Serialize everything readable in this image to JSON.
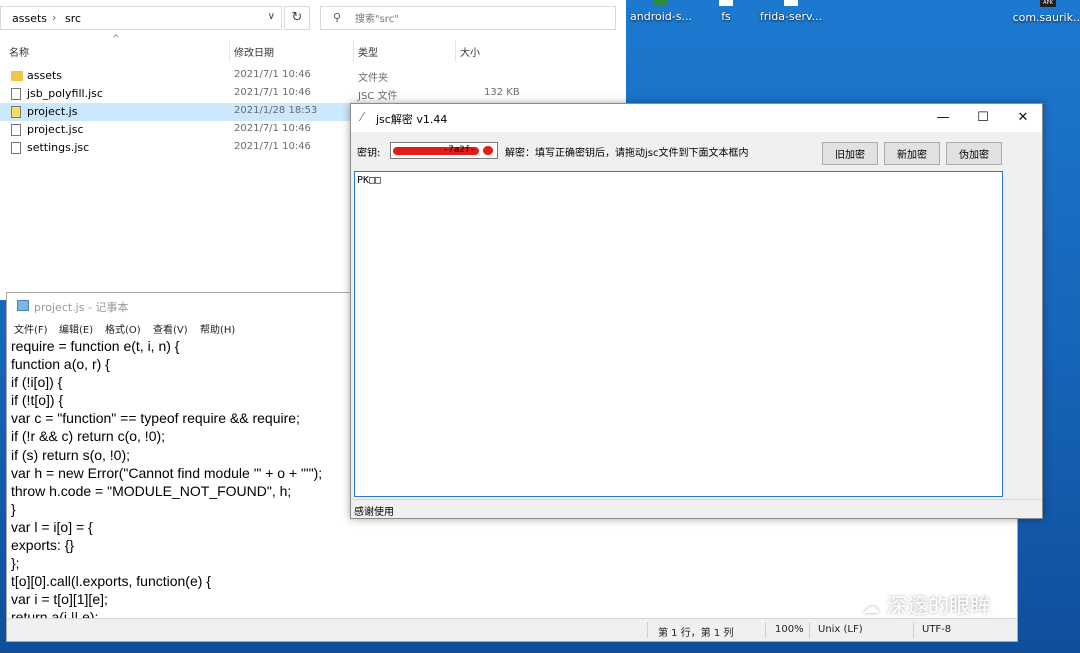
{
  "desktop": {
    "icons": [
      {
        "label": "android-s...",
        "icon": "android-server-icon"
      },
      {
        "label": "fs",
        "icon": "file-icon"
      },
      {
        "label": "frida-serv...",
        "icon": "file-icon"
      },
      {
        "label": "com.saurik...",
        "icon": "apk-icon",
        "badge": "APK"
      }
    ]
  },
  "explorer": {
    "breadcrumb": [
      "assets",
      "src"
    ],
    "search_placeholder": "搜索\"src\"",
    "columns": {
      "name": "名称",
      "date": "修改日期",
      "type": "类型",
      "size": "大小"
    },
    "files": [
      {
        "name": "assets",
        "date": "2021/7/1 10:46",
        "type": "文件夹",
        "size": "",
        "icon": "folder-icon"
      },
      {
        "name": "jsb_polyfill.jsc",
        "date": "2021/7/1 10:46",
        "type": "JSC 文件",
        "size": "132 KB",
        "icon": "file-icon"
      },
      {
        "name": "project.js",
        "date": "2021/1/28 18:53",
        "type": "",
        "size": "",
        "icon": "js-file-icon",
        "selected": true
      },
      {
        "name": "project.jsc",
        "date": "2021/7/1 10:46",
        "type": "",
        "size": "",
        "icon": "file-icon"
      },
      {
        "name": "settings.jsc",
        "date": "2021/7/1 10:46",
        "type": "",
        "size": "",
        "icon": "file-icon"
      }
    ]
  },
  "notepad": {
    "title": "project.js - 记事本",
    "menu": [
      "文件(F)",
      "编辑(E)",
      "格式(O)",
      "查看(V)",
      "帮助(H)"
    ],
    "lines": [
      "require = function e(t, i, n) {",
      "function a(o, r) {",
      "if (!i[o]) {",
      "if (!t[o]) {",
      "var c = \"function\" == typeof require && require;",
      "if (!r && c) return c(o, !0);",
      "if (s) return s(o, !0);",
      "var h = new Error(\"Cannot find module '\" + o + \"'\");",
      "throw h.code = \"MODULE_NOT_FOUND\", h;",
      "}",
      "var l = i[o] = {",
      "exports: {}",
      "};",
      "t[o][0].call(l.exports, function(e) {",
      "var i = t[o][1][e];",
      "return a(i || e);"
    ],
    "status": {
      "position": "第 1 行，第 1 列",
      "zoom": "100%",
      "eol": "Unix (LF)",
      "encoding": "UTF-8"
    }
  },
  "jsc": {
    "title": "jsc解密 v1.44",
    "key_label": "密钥:",
    "key_value_visible": "-7a2f-",
    "hint": "解密：填写正确密钥后，请拖动jsc文件到下面文本框内",
    "buttons": {
      "old_encrypt": "旧加密",
      "new_encrypt": "新加密",
      "fake_encrypt": "伪加密"
    },
    "content": "PK□□",
    "status": "感谢使用"
  },
  "watermark": "深邃的眼眸"
}
